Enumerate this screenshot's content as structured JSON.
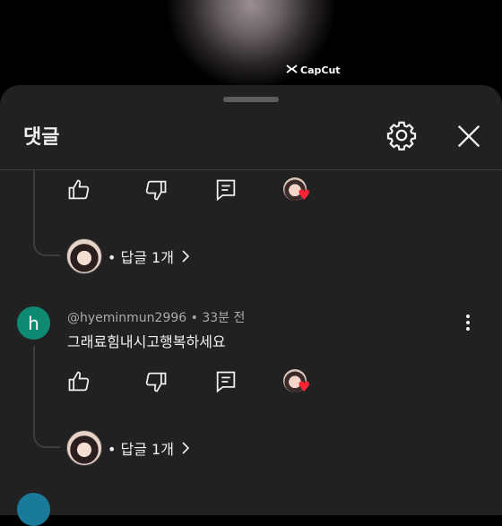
{
  "video": {
    "watermark": "CapCut"
  },
  "sheet": {
    "title": "댓글"
  },
  "comments": [
    {
      "reply_count_label": "• 답글 1개"
    },
    {
      "avatar_letter": "h",
      "meta": "@hyeminmun2996 • 33분 전",
      "text": "그래료힘내시고행복하세요",
      "reply_count_label": "• 답글 1개"
    }
  ],
  "colors": {
    "sheet_bg": "#212121",
    "heart": "#ff2233",
    "avatar_h": "#0e8a72"
  }
}
